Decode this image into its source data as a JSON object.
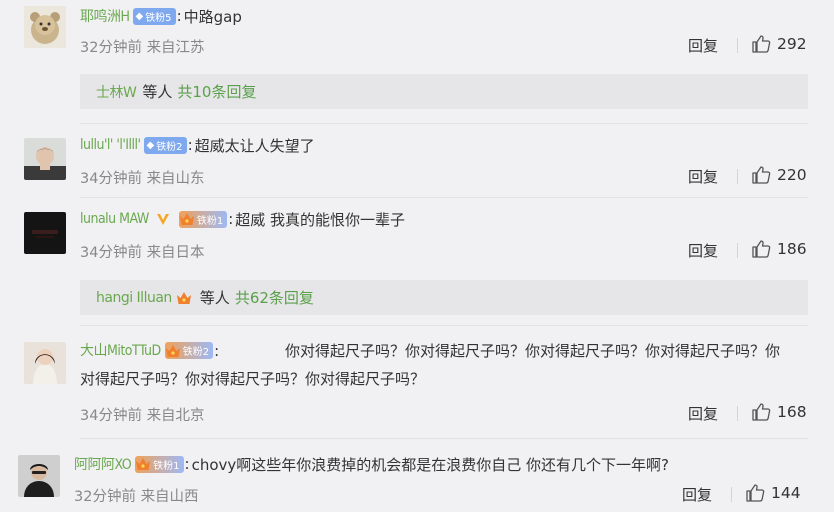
{
  "reply_label": "回复",
  "comments": [
    {
      "username": "耶鸣洲H",
      "badge": "铁粉5",
      "badge_style": "gem",
      "text": "中路gap",
      "time": "32分钟前",
      "location": "来自江苏",
      "likes": "292",
      "sub": {
        "name": "士林W",
        "etc": "等人",
        "count": "共10条回复"
      }
    },
    {
      "username": "lullu'l' 'l'Illl'",
      "badge": "铁粉2",
      "badge_style": "gem",
      "text": "超威太让人失望了",
      "time": "34分钟前",
      "location": "来自山东",
      "likes": "220"
    },
    {
      "username": "lunalu MAW",
      "badge": "铁粉1",
      "badge_style": "crown",
      "text": "超威 我真的能恨你一辈子",
      "time": "34分钟前",
      "location": "来自日本",
      "likes": "186",
      "sub": {
        "name": "hangi Illuan",
        "etc": "等人",
        "count": "共62条回复"
      }
    },
    {
      "username": "大山MitoTTuD",
      "badge": "铁粉2",
      "badge_style": "crown",
      "text": "你对得起尺子吗？你对得起尺子吗？你对得起尺子吗？你对得起尺子吗？你对得起尺子吗？你对得起尺子吗？你对得起尺子吗？",
      "time": "34分钟前",
      "location": "来自北京",
      "likes": "168"
    },
    {
      "username": "阿阿阿XO",
      "badge": "铁粉1",
      "badge_style": "crown",
      "text": "chovy啊这些年你浪费掉的机会都是在浪费你自己 你还有几个下一年啊?",
      "time": "32分钟前",
      "location": "来自山西",
      "likes": "144"
    }
  ]
}
